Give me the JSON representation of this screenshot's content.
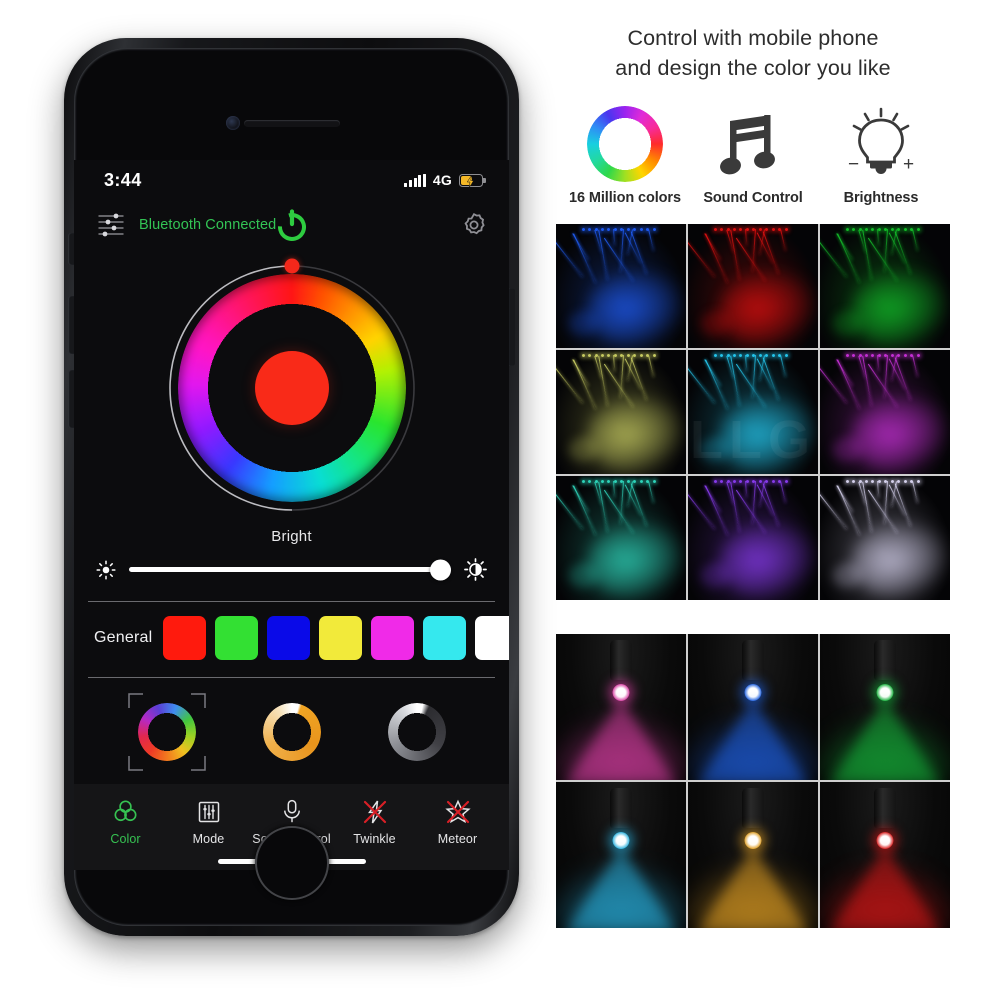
{
  "phone": {
    "status_bar": {
      "time": "3:44",
      "network": "4G",
      "signal_bars": 5,
      "battery_icon": "battery-charging-icon"
    },
    "app_bar": {
      "menu_icon": "equalizer-sliders-icon",
      "connection_status": "Bluetooth Connected",
      "power_icon": "power-button-icon",
      "settings_icon": "gear-icon",
      "status_color": "#33c455"
    },
    "color_wheel": {
      "selected_color": "#f92a18",
      "handle_color": "#f4281b",
      "handle_angle_deg": 0
    },
    "brightness": {
      "label": "Bright",
      "value": 100,
      "min_icon": "sun-small-icon",
      "max_icon": "sun-large-icon"
    },
    "general": {
      "label": "General",
      "swatches": [
        {
          "name": "red",
          "hex": "#ff1a0d"
        },
        {
          "name": "green",
          "hex": "#33e033"
        },
        {
          "name": "blue",
          "hex": "#0a0ae8"
        },
        {
          "name": "yellow",
          "hex": "#f2ea3a"
        },
        {
          "name": "magenta",
          "hex": "#f02ae8"
        },
        {
          "name": "cyan",
          "hex": "#35e8ee"
        },
        {
          "name": "white",
          "hex": "#ffffff"
        }
      ]
    },
    "presets": [
      {
        "name": "rainbow-ring",
        "selected": true
      },
      {
        "name": "warm-white-ring",
        "selected": false
      },
      {
        "name": "cool-white-ring",
        "selected": false
      }
    ],
    "tabs": [
      {
        "label": "Color",
        "icon": "color-circles-icon",
        "active": true,
        "disabled": false
      },
      {
        "label": "Mode",
        "icon": "sliders-box-icon",
        "active": false,
        "disabled": false
      },
      {
        "label": "Sound control",
        "icon": "microphone-icon",
        "active": false,
        "disabled": false
      },
      {
        "label": "Twinkle",
        "icon": "lightning-bolt-icon",
        "active": false,
        "disabled": true
      },
      {
        "label": "Meteor",
        "icon": "star-icon",
        "active": false,
        "disabled": true
      }
    ]
  },
  "promo": {
    "headline_line1": "Control with mobile phone",
    "headline_line2": "and design the color you like",
    "features": [
      {
        "label": "16 Million colors",
        "icon": "color-wheel-icon"
      },
      {
        "label": "Sound Control",
        "icon": "music-note-icon"
      },
      {
        "label": "Brightness",
        "icon": "light-bulb-icon"
      }
    ],
    "bulb_minus": "−",
    "bulb_plus": "+",
    "fiber_grid": [
      {
        "name": "fiber-blue",
        "hex": "#1f5cf5"
      },
      {
        "name": "fiber-red",
        "hex": "#e01010"
      },
      {
        "name": "fiber-green",
        "hex": "#13c02a"
      },
      {
        "name": "fiber-yellow",
        "hex": "#c9cd63"
      },
      {
        "name": "fiber-cyan",
        "hex": "#25c8ef"
      },
      {
        "name": "fiber-magenta",
        "hex": "#c831d8"
      },
      {
        "name": "fiber-teal",
        "hex": "#2fd6bc"
      },
      {
        "name": "fiber-purple",
        "hex": "#8a3cf0"
      },
      {
        "name": "fiber-white",
        "hex": "#d8d4f0"
      }
    ],
    "spot_grid": [
      {
        "name": "spot-magenta",
        "hex": "#e040a8"
      },
      {
        "name": "spot-blue",
        "hex": "#1f63e8"
      },
      {
        "name": "spot-green",
        "hex": "#16b83c"
      },
      {
        "name": "spot-cyan",
        "hex": "#2ab8e8"
      },
      {
        "name": "spot-amber",
        "hex": "#e8a424"
      },
      {
        "name": "spot-red",
        "hex": "#e01818"
      }
    ],
    "watermark": "LLG"
  }
}
